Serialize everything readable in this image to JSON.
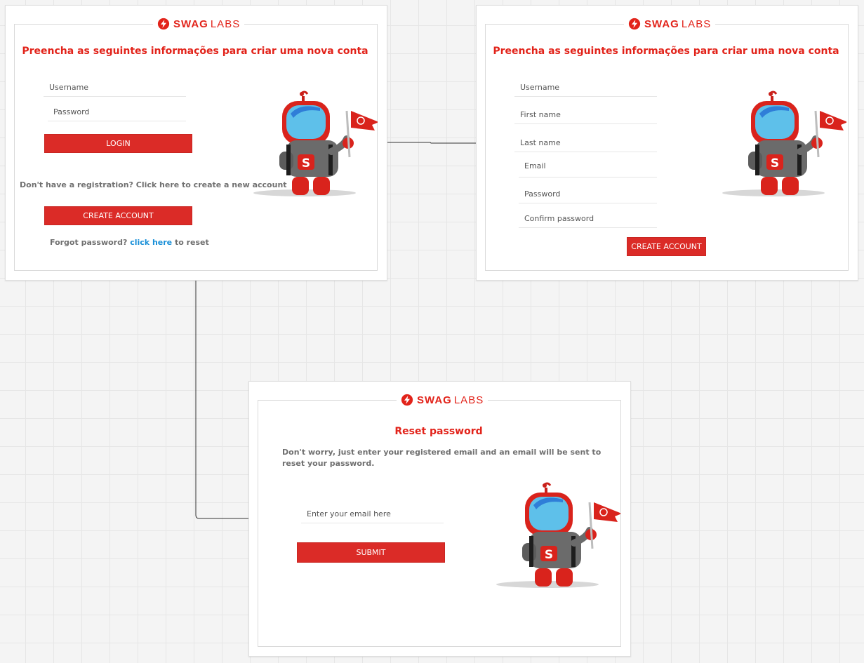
{
  "brand": {
    "swag": "SWAG",
    "labs": "LABS",
    "logo_icon": "swaglabs-bolt-icon",
    "color": "#e2231a"
  },
  "colors": {
    "accent": "#e2231a",
    "button": "#db2b27",
    "link": "#1a90d8",
    "muted": "#707070"
  },
  "login": {
    "title": "Preencha as seguintes informações para criar uma nova conta",
    "username_placeholder": "Username",
    "password_placeholder": "Password",
    "login_button": "LOGIN",
    "register_prompt": "Don't have a registration? Click here to create a new account",
    "create_account_button": "CREATE ACCOUNT",
    "forgot_prefix": "Forgot password?",
    "forgot_link": "click here",
    "forgot_suffix": "to reset"
  },
  "register": {
    "title": "Preencha as seguintes informações para criar uma nova conta",
    "username_placeholder": "Username",
    "first_name_placeholder": "First name",
    "last_name_placeholder": "Last name",
    "email_placeholder": "Email",
    "password_placeholder": "Password",
    "confirm_password_placeholder": "Confirm password",
    "create_account_button": "CREATE ACCOUNT"
  },
  "reset": {
    "title": "Reset password",
    "description": "Don't worry, just enter your registered email and an email will be sent to reset your password.",
    "email_placeholder": "Enter your email here",
    "submit_button": "SUBMIT"
  },
  "mascot": {
    "icon": "robot-mascot-with-flag-icon"
  }
}
